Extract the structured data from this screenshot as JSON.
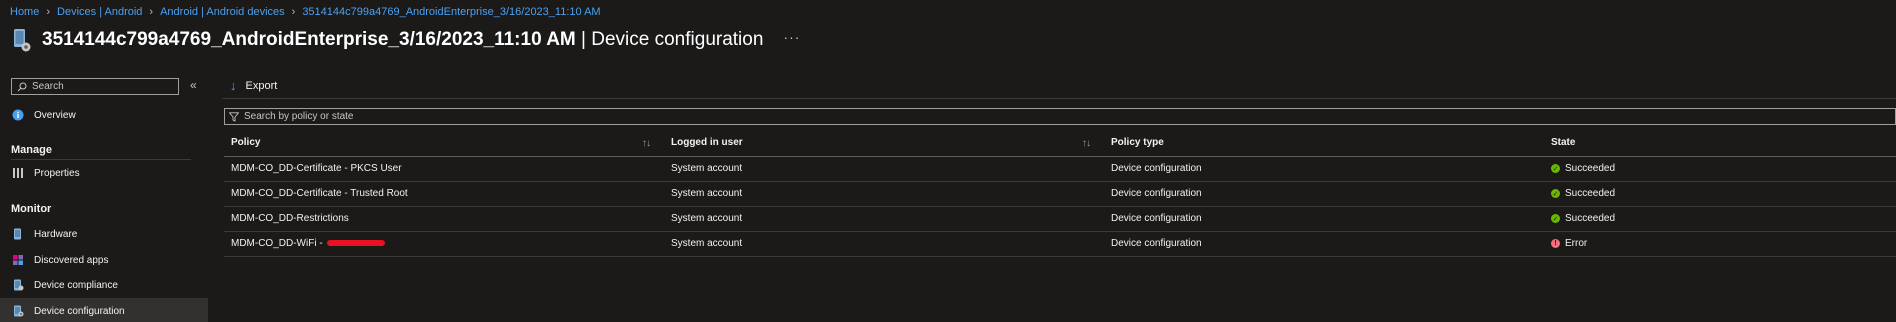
{
  "breadcrumb": [
    "Home",
    "Devices | Android",
    "Android | Android devices",
    "3514144c799a4769_AndroidEnterprise_3/16/2023_11:10 AM"
  ],
  "header": {
    "device_title": "3514144c799a4769_AndroidEnterprise_3/16/2023_11:10 AM",
    "page_subtitle": " | Device configuration",
    "more_label": "···"
  },
  "sidebar": {
    "search_placeholder": "Search",
    "collapse_label": "«",
    "overview": "Overview",
    "manage_section": "Manage",
    "properties": "Properties",
    "monitor_section": "Monitor",
    "hardware": "Hardware",
    "discovered_apps": "Discovered apps",
    "device_compliance": "Device compliance",
    "device_configuration": "Device configuration"
  },
  "toolbar": {
    "export_label": "Export"
  },
  "filter": {
    "placeholder": "Search by policy or state"
  },
  "table": {
    "columns": [
      "Policy",
      "Logged in user",
      "Policy type",
      "State"
    ],
    "rows": [
      {
        "policy": "MDM-CO_DD-Certificate - PKCS User",
        "user": "System account",
        "type": "Device configuration",
        "state": "Succeeded"
      },
      {
        "policy": "MDM-CO_DD-Certificate - Trusted Root",
        "user": "System account",
        "type": "Device configuration",
        "state": "Succeeded"
      },
      {
        "policy": "MDM-CO_DD-Restrictions",
        "user": "System account",
        "type": "Device configuration",
        "state": "Succeeded"
      },
      {
        "policy": "MDM-CO_DD-WiFi - ",
        "user": "System account",
        "type": "Device configuration",
        "state": "Error"
      }
    ]
  },
  "colors": {
    "link": "#4aa0f0",
    "success": "#6bb700",
    "error": "#f1707b",
    "background": "#1b1a19"
  }
}
